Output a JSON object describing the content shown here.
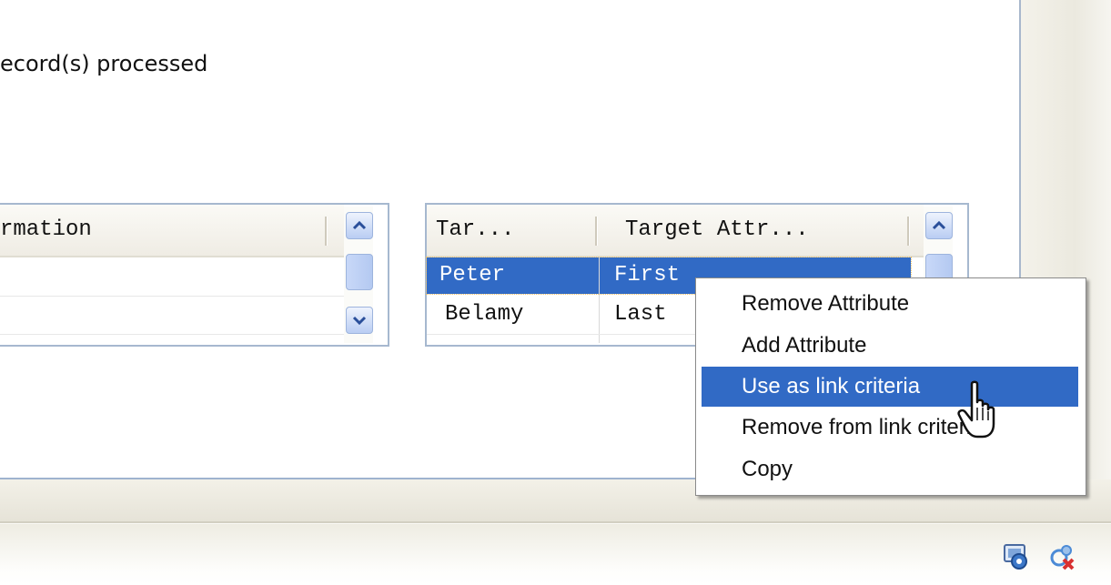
{
  "status_text": "ecord(s) processed",
  "left_table": {
    "header": "rmation",
    "rows": [
      "",
      ""
    ]
  },
  "right_table": {
    "columns": [
      "Tar...",
      "Target Attr..."
    ],
    "rows": [
      {
        "c1": "Peter",
        "c2": "First",
        "selected": true
      },
      {
        "c1": "Belamy",
        "c2": "Last",
        "selected": false
      }
    ]
  },
  "context_menu": {
    "items": [
      {
        "label": "Remove Attribute"
      },
      {
        "label": "Add Attribute"
      },
      {
        "label": "Use as link criteria",
        "highlighted": true
      },
      {
        "label": "Remove from link criteria"
      },
      {
        "label": "Copy"
      }
    ]
  },
  "colors": {
    "selection": "#316ac5",
    "table_border": "#a6b8cf",
    "scroll_button": "#b9cdf3"
  },
  "icons": [
    "scroll-up-icon",
    "scroll-down-icon",
    "mouse-pointer-icon",
    "network-status-icon",
    "connection-error-icon"
  ]
}
